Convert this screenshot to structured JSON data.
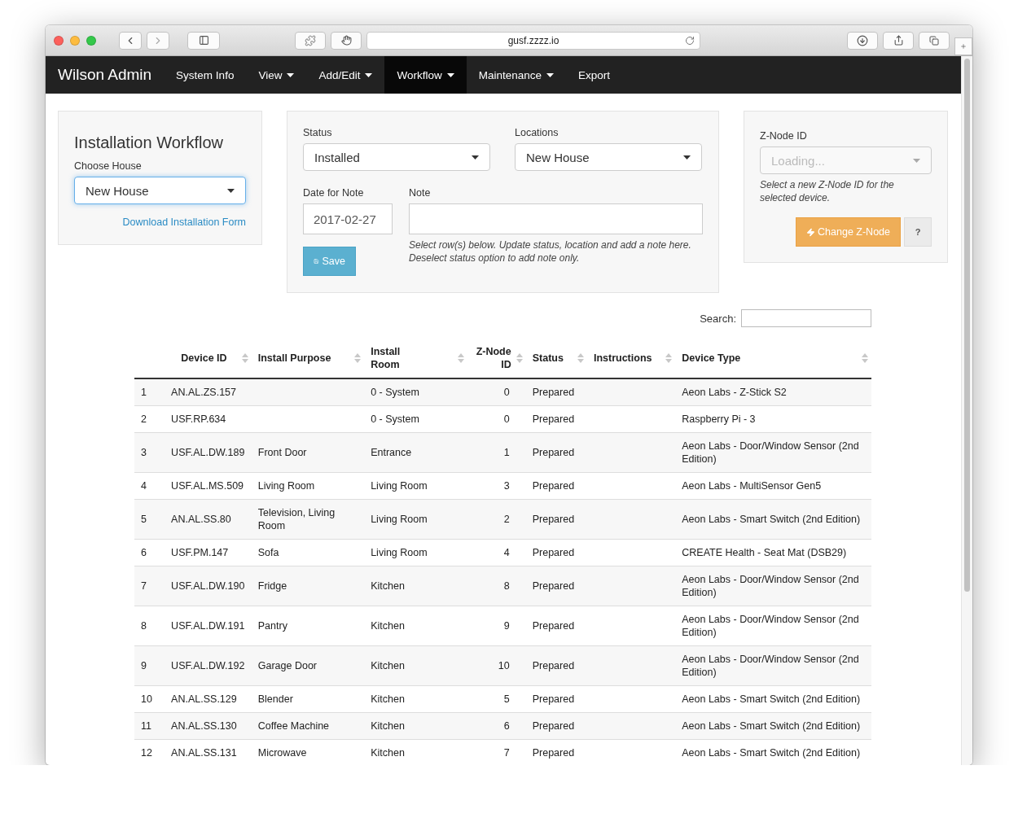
{
  "browser": {
    "url": "gusf.zzzz.io"
  },
  "nav": {
    "brand": "Wilson Admin",
    "items": [
      {
        "label": "System Info",
        "dropdown": false,
        "selected": false
      },
      {
        "label": "View",
        "dropdown": true,
        "selected": false
      },
      {
        "label": "Add/Edit",
        "dropdown": true,
        "selected": false
      },
      {
        "label": "Workflow",
        "dropdown": true,
        "selected": true
      },
      {
        "label": "Maintenance",
        "dropdown": true,
        "selected": false
      },
      {
        "label": "Export",
        "dropdown": false,
        "selected": false
      }
    ]
  },
  "workflow_panel": {
    "title": "Installation Workflow",
    "house_label": "Choose House",
    "house_value": "New House",
    "download_link": "Download Installation Form"
  },
  "update_panel": {
    "status_label": "Status",
    "status_value": "Installed",
    "locations_label": "Locations",
    "locations_value": "New House",
    "date_label": "Date for Note",
    "date_value": "2017-02-27",
    "note_label": "Note",
    "help": "Select row(s) below. Update status, location and add a note here. Deselect status option to add note only.",
    "save": "Save"
  },
  "znode_panel": {
    "label": "Z-Node ID",
    "placeholder": "Loading...",
    "disabled": true,
    "help": "Select a new Z-Node ID for the selected device.",
    "change": "Change Z-Node",
    "help_button": "?"
  },
  "table": {
    "search_label": "Search:",
    "columns": [
      {
        "label": "Device ID",
        "sortable": true
      },
      {
        "label": "Install Purpose",
        "sortable": true
      },
      {
        "label": "Install Room",
        "sortable": true
      },
      {
        "label": "Z-Node ID",
        "sortable": true
      },
      {
        "label": "Status",
        "sortable": true
      },
      {
        "label": "Instructions",
        "sortable": true
      },
      {
        "label": "Device Type",
        "sortable": true
      }
    ],
    "rows": [
      {
        "number": "1",
        "device_id": "AN.AL.ZS.157",
        "install_room": "0 - System",
        "znode_id": "0",
        "status": "Prepared",
        "device_type": "Aeon Labs - Z-Stick S2"
      },
      {
        "number": "2",
        "device_id": "USF.RP.634",
        "install_room": "0 - System",
        "znode_id": "0",
        "status": "Prepared",
        "device_type": "Raspberry Pi - 3"
      },
      {
        "number": "3",
        "device_id": "USF.AL.DW.189",
        "install_purpose": "Front Door",
        "install_room": "Entrance",
        "znode_id": "1",
        "status": "Prepared",
        "device_type": "Aeon Labs - Door/Window Sensor (2nd Edition)"
      },
      {
        "number": "4",
        "device_id": "USF.AL.MS.509",
        "install_purpose": "Living Room",
        "install_room": "Living Room",
        "znode_id": "3",
        "status": "Prepared",
        "device_type": "Aeon Labs - MultiSensor Gen5"
      },
      {
        "number": "5",
        "device_id": "AN.AL.SS.80",
        "install_purpose": "Television, Living Room",
        "install_room": "Living Room",
        "znode_id": "2",
        "status": "Prepared",
        "device_type": "Aeon Labs - Smart Switch (2nd Edition)"
      },
      {
        "number": "6",
        "device_id": "USF.PM.147",
        "install_purpose": "Sofa",
        "install_room": "Living Room",
        "znode_id": "4",
        "status": "Prepared",
        "device_type": "CREATE Health - Seat Mat (DSB29)"
      },
      {
        "number": "7",
        "device_id": "USF.AL.DW.190",
        "install_purpose": "Fridge",
        "install_room": "Kitchen",
        "znode_id": "8",
        "status": "Prepared",
        "device_type": "Aeon Labs - Door/Window Sensor (2nd Edition)"
      },
      {
        "number": "8",
        "device_id": "USF.AL.DW.191",
        "install_purpose": "Pantry",
        "install_room": "Kitchen",
        "znode_id": "9",
        "status": "Prepared",
        "device_type": "Aeon Labs - Door/Window Sensor (2nd Edition)"
      },
      {
        "number": "9",
        "device_id": "USF.AL.DW.192",
        "install_purpose": "Garage Door",
        "install_room": "Kitchen",
        "znode_id": "10",
        "status": "Prepared",
        "device_type": "Aeon Labs - Door/Window Sensor (2nd Edition)"
      },
      {
        "number": "10",
        "device_id": "AN.AL.SS.129",
        "install_purpose": "Blender",
        "install_room": "Kitchen",
        "znode_id": "5",
        "status": "Prepared",
        "device_type": "Aeon Labs - Smart Switch (2nd Edition)"
      },
      {
        "number": "11",
        "device_id": "AN.AL.SS.130",
        "install_purpose": "Coffee Machine",
        "install_room": "Kitchen",
        "znode_id": "6",
        "status": "Prepared",
        "device_type": "Aeon Labs - Smart Switch (2nd Edition)"
      },
      {
        "number": "12",
        "device_id": "AN.AL.SS.131",
        "install_purpose": "Microwave",
        "install_room": "Kitchen",
        "znode_id": "7",
        "status": "Prepared",
        "device_type": "Aeon Labs - Smart Switch (2nd Edition)"
      }
    ]
  }
}
